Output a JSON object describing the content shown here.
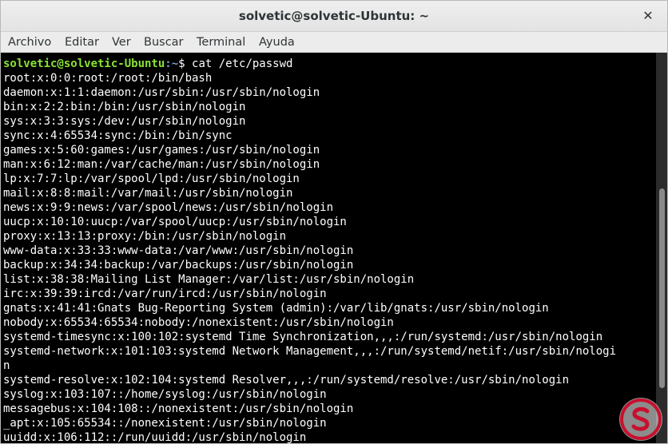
{
  "window": {
    "title": "solvetic@solvetic-Ubuntu: ~"
  },
  "menubar": {
    "items": [
      {
        "label": "Archivo"
      },
      {
        "label": "Editar"
      },
      {
        "label": "Ver"
      },
      {
        "label": "Buscar"
      },
      {
        "label": "Terminal"
      },
      {
        "label": "Ayuda"
      }
    ]
  },
  "terminal": {
    "prompt_user": "solvetic@solvetic-Ubuntu",
    "prompt_path": ":~",
    "prompt_cmd": "$ cat /etc/passwd",
    "lines": [
      "root:x:0:0:root:/root:/bin/bash",
      "daemon:x:1:1:daemon:/usr/sbin:/usr/sbin/nologin",
      "bin:x:2:2:bin:/bin:/usr/sbin/nologin",
      "sys:x:3:3:sys:/dev:/usr/sbin/nologin",
      "sync:x:4:65534:sync:/bin:/bin/sync",
      "games:x:5:60:games:/usr/games:/usr/sbin/nologin",
      "man:x:6:12:man:/var/cache/man:/usr/sbin/nologin",
      "lp:x:7:7:lp:/var/spool/lpd:/usr/sbin/nologin",
      "mail:x:8:8:mail:/var/mail:/usr/sbin/nologin",
      "news:x:9:9:news:/var/spool/news:/usr/sbin/nologin",
      "uucp:x:10:10:uucp:/var/spool/uucp:/usr/sbin/nologin",
      "proxy:x:13:13:proxy:/bin:/usr/sbin/nologin",
      "www-data:x:33:33:www-data:/var/www:/usr/sbin/nologin",
      "backup:x:34:34:backup:/var/backups:/usr/sbin/nologin",
      "list:x:38:38:Mailing List Manager:/var/list:/usr/sbin/nologin",
      "irc:x:39:39:ircd:/var/run/ircd:/usr/sbin/nologin",
      "gnats:x:41:41:Gnats Bug-Reporting System (admin):/var/lib/gnats:/usr/sbin/nologin",
      "nobody:x:65534:65534:nobody:/nonexistent:/usr/sbin/nologin",
      "systemd-timesync:x:100:102:systemd Time Synchronization,,,:/run/systemd:/usr/sbin/nologin",
      "systemd-network:x:101:103:systemd Network Management,,,:/run/systemd/netif:/usr/sbin/nologi",
      "n",
      "systemd-resolve:x:102:104:systemd Resolver,,,:/run/systemd/resolve:/usr/sbin/nologin",
      "syslog:x:103:107::/home/syslog:/usr/sbin/nologin",
      "messagebus:x:104:108::/nonexistent:/usr/sbin/nologin",
      "_apt:x:105:65534::/nonexistent:/usr/sbin/nologin",
      "uuidd:x:106:112::/run/uuidd:/usr/sbin/nologin"
    ]
  },
  "colors": {
    "prompt_user": "#8ae234",
    "prompt_path": "#729fcf",
    "terminal_bg": "#000000",
    "watermark": "#c8102e"
  },
  "icons": {
    "close": "close-icon",
    "watermark": "solvetic-logo"
  }
}
